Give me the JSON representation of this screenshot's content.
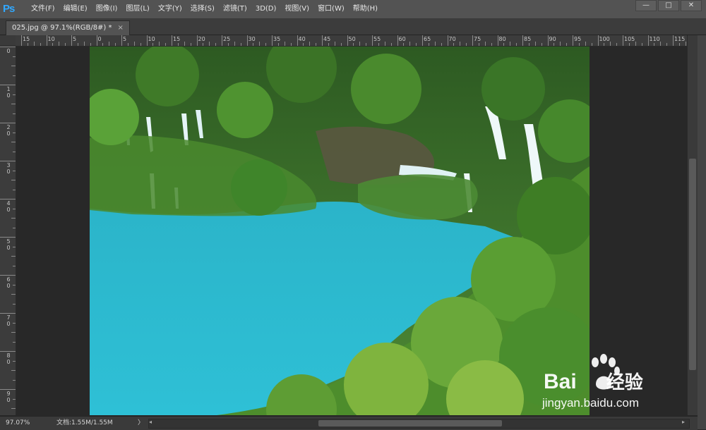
{
  "app": {
    "logo": "Ps"
  },
  "menu": [
    "文件(F)",
    "编辑(E)",
    "图像(I)",
    "图层(L)",
    "文字(Y)",
    "选择(S)",
    "滤镜(T)",
    "3D(D)",
    "视图(V)",
    "窗口(W)",
    "帮助(H)"
  ],
  "window_controls": {
    "minimize": "—",
    "maximize": "□",
    "close": "✕"
  },
  "document_tab": {
    "title": "025.jpg @ 97.1%(RGB/8#) *",
    "close": "×"
  },
  "ruler_top_labels": [
    "15",
    "10",
    "5",
    "0",
    "5",
    "10",
    "15",
    "20",
    "25",
    "30",
    "35",
    "40",
    "45",
    "50",
    "55",
    "60",
    "65",
    "70",
    "75",
    "80",
    "85",
    "90",
    "95",
    "100",
    "105",
    "110",
    "115"
  ],
  "ruler_left_labels": [
    "0",
    "1 0",
    "2 0",
    "3 0",
    "4 0",
    "5 0",
    "6 0",
    "7 0",
    "8 0",
    "9 0"
  ],
  "watermark": {
    "brand": "Bai",
    "brand_suffix": "经验",
    "url": "jingyan.baidu.com"
  },
  "status": {
    "zoom": "97.07%",
    "doc_size": "文档:1.55M/1.55M",
    "arrow": "〉"
  },
  "colors": {
    "ui_bg": "#535353",
    "accent": "#31a8ff",
    "lake": "#2fb8cc",
    "forest": "#3f7a2a"
  }
}
